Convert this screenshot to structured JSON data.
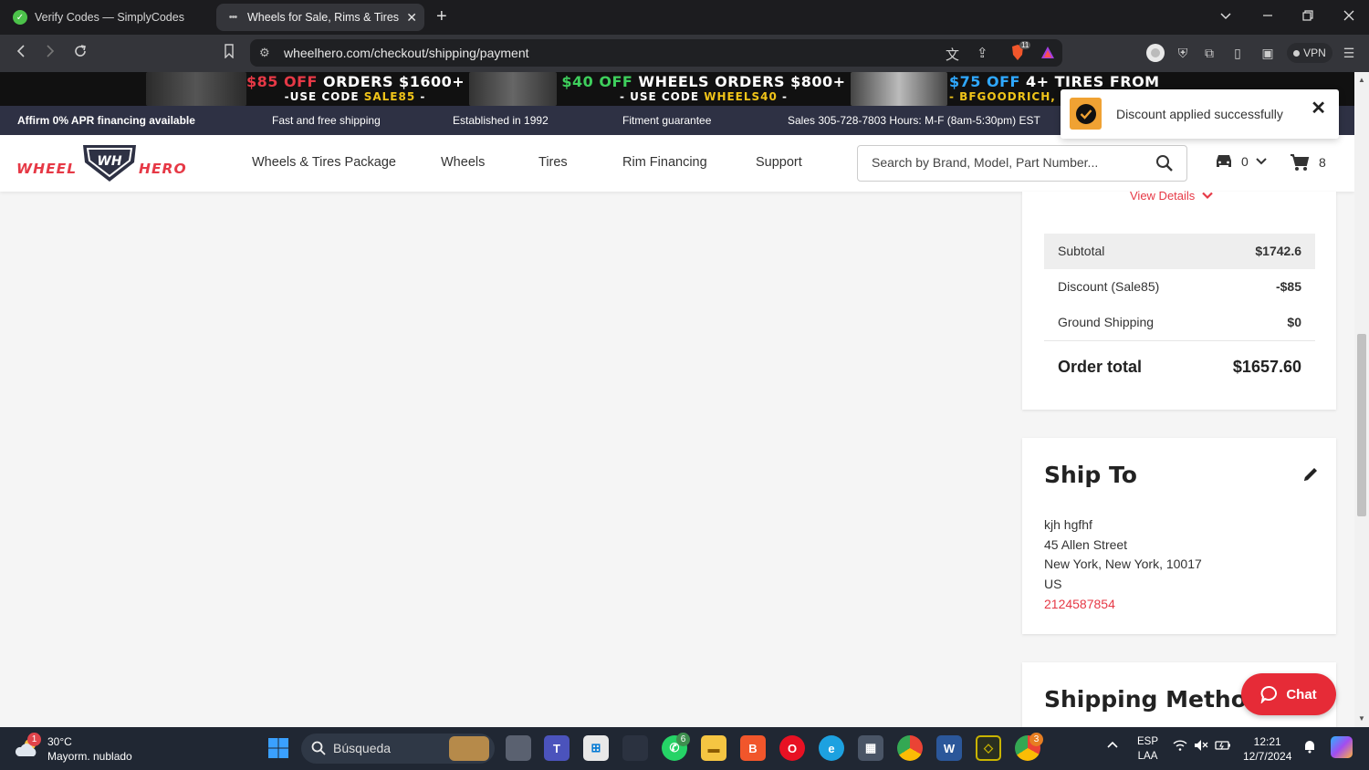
{
  "browser": {
    "tabs": [
      {
        "title": "Verify Codes — SimplyCodes",
        "active": false
      },
      {
        "title": "Wheels for Sale, Rims & Tires fo",
        "active": true
      }
    ],
    "url": "wheelhero.com/checkout/shipping/payment",
    "vpn_label": "VPN",
    "brave_badge": "11"
  },
  "promo": [
    {
      "amount": "$85 OFF",
      "text": " ORDERS $1600+",
      "code_prefix": "-USE CODE ",
      "code": "SALE85",
      "code_suffix": " -"
    },
    {
      "amount": "$40 OFF",
      "text": " WHEELS ORDERS $800+",
      "code_prefix": "- USE CODE ",
      "code": "WHEELS40",
      "code_suffix": " -"
    },
    {
      "amount": "$75 OFF",
      "text": " 4+ TIRES FROM",
      "code_prefix": "- ",
      "code": "BFGOODRICH, MIC",
      "code_suffix": ""
    }
  ],
  "infobar": {
    "affirm": "Affirm 0% APR financing available",
    "shipping": "Fast and free shipping",
    "established": "Established in 1992",
    "fitment": "Fitment guarantee",
    "sales": "Sales 305-728-7803 Hours: M-F (8am-5:30pm) EST"
  },
  "header": {
    "logo_left": "WHEEL",
    "logo_mid": "WH",
    "logo_right": "HERO",
    "menu": [
      "Wheels & Tires Package",
      "Wheels",
      "Tires",
      "Rim Financing",
      "Support"
    ],
    "search_placeholder": "Search by Brand, Model, Part Number...",
    "garage_count": "0",
    "cart_count": "8"
  },
  "toast": {
    "message": "Discount applied successfully"
  },
  "summary": {
    "view_details": "View Details",
    "rows": [
      {
        "label": "Subtotal",
        "value": "$1742.6"
      },
      {
        "label": "Discount (Sale85)",
        "value": "-$85"
      },
      {
        "label": "Ground Shipping",
        "value": "$0"
      }
    ],
    "total_label": "Order total",
    "total_value": "$1657.60"
  },
  "ship_to": {
    "title": "Ship To",
    "name": "kjh hgfhf",
    "street": "45 Allen Street",
    "city": "New York, New York, 10017",
    "country": "US",
    "phone": "2124587854"
  },
  "shipping_method": {
    "title": "Shipping Method"
  },
  "chat": {
    "label": "Chat"
  },
  "taskbar": {
    "weather_temp": "30°C",
    "weather_desc": "Mayorm. nublado",
    "weather_badge": "1",
    "search_label": "Búsqueda",
    "whatsapp_badge": "6",
    "chrome_badge": "3",
    "lang_top": "ESP",
    "lang_bottom": "LAA",
    "time": "12:21",
    "date": "12/7/2024"
  },
  "colors": {
    "brand_red": "#e63946",
    "header_dark": "#2e3144",
    "toast_check": "#f0a233"
  }
}
